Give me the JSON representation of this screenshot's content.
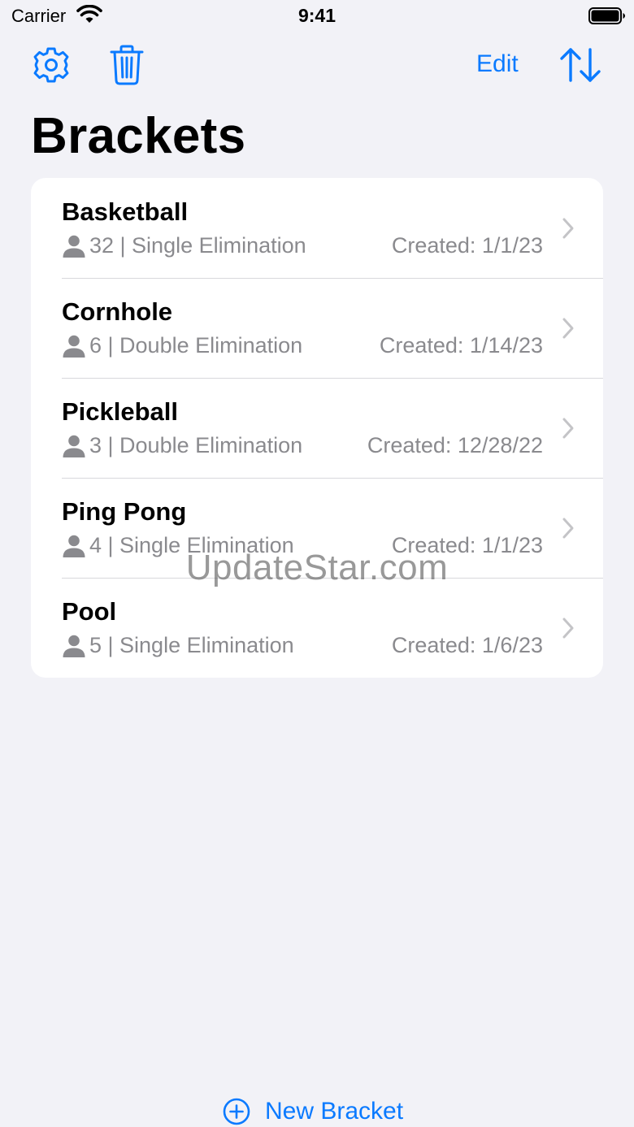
{
  "status_bar": {
    "carrier": "Carrier",
    "time": "9:41"
  },
  "nav": {
    "edit_label": "Edit",
    "title": "Brackets",
    "icons": [
      "gear-icon",
      "trash-icon",
      "sort-arrows-icon"
    ]
  },
  "brackets": [
    {
      "name": "Basketball",
      "meta": "32 | Single Elimination",
      "created": "Created: 1/1/23"
    },
    {
      "name": "Cornhole",
      "meta": "6 | Double Elimination",
      "created": "Created: 1/14/23"
    },
    {
      "name": "Pickleball",
      "meta": "3 | Double Elimination",
      "created": "Created: 12/28/22"
    },
    {
      "name": "Ping Pong",
      "meta": "4 | Single Elimination",
      "created": "Created: 1/1/23"
    },
    {
      "name": "Pool",
      "meta": "5 | Single Elimination",
      "created": "Created: 1/6/23"
    }
  ],
  "watermark": "UpdateStar.com",
  "footer": {
    "new_bracket_label": "New Bracket"
  },
  "colors": {
    "accent": "#0a7aff",
    "background": "#f2f2f7",
    "secondary_text": "#8a8a8e"
  }
}
